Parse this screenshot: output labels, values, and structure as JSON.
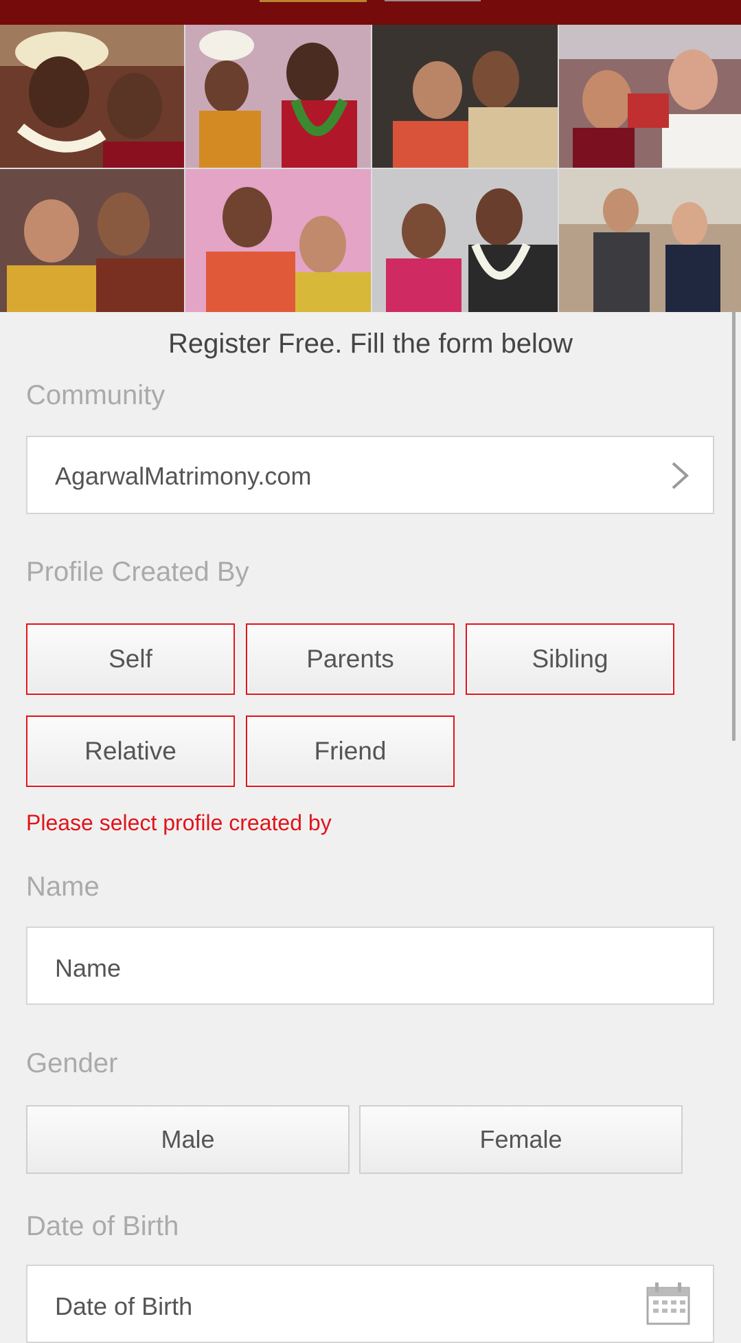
{
  "header": {
    "brand_color": "#760b0b"
  },
  "collage": {
    "photos": [
      {
        "icon": "couple-photo-1"
      },
      {
        "icon": "couple-photo-2"
      },
      {
        "icon": "couple-photo-3"
      },
      {
        "icon": "couple-photo-4"
      },
      {
        "icon": "couple-photo-5"
      },
      {
        "icon": "couple-photo-6"
      },
      {
        "icon": "couple-photo-7"
      },
      {
        "icon": "couple-photo-8"
      }
    ]
  },
  "form": {
    "title": "Register Free. Fill the form below",
    "community": {
      "label": "Community",
      "value": "AgarwalMatrimony.com",
      "icon": "chevron-right-icon"
    },
    "profile_created_by": {
      "label": "Profile Created By",
      "options": [
        "Self",
        "Parents",
        "Sibling",
        "Relative",
        "Friend"
      ],
      "error": "Please select profile created by"
    },
    "name": {
      "label": "Name",
      "placeholder": "Name"
    },
    "gender": {
      "label": "Gender",
      "options": [
        "Male",
        "Female"
      ]
    },
    "dob": {
      "label": "Date of Birth",
      "placeholder": "Date of Birth",
      "icon": "calendar-icon"
    }
  },
  "colors": {
    "error": "#e0141a",
    "label": "#aaaaaa",
    "text": "#555555"
  }
}
